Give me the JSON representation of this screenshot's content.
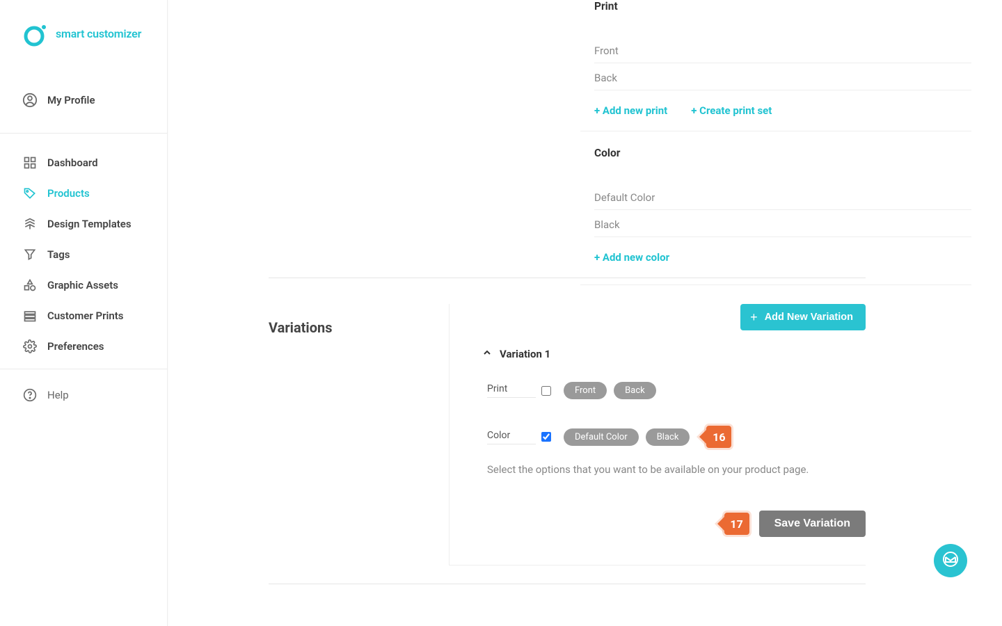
{
  "brand": "smart customizer",
  "sidebar": {
    "profile": "My Profile",
    "items": [
      "Dashboard",
      "Products",
      "Design Templates",
      "Tags",
      "Graphic Assets",
      "Customer Prints",
      "Preferences"
    ],
    "help": "Help"
  },
  "options": {
    "print": {
      "heading": "Print",
      "rows": [
        "Front",
        "Back"
      ],
      "add_new": "+ Add new print",
      "create_set": "+ Create print set"
    },
    "color": {
      "heading": "Color",
      "rows": [
        "Default Color",
        "Black"
      ],
      "add_new": "+ Add new color"
    }
  },
  "variations": {
    "title": "Variations",
    "add_new": "Add New Variation",
    "variation1": {
      "title": "Variation 1",
      "print_label": "Print",
      "print_pills": [
        "Front",
        "Back"
      ],
      "color_label": "Color",
      "color_pills": [
        "Default Color",
        "Black"
      ],
      "help": "Select the options that you want to be available on your product page.",
      "save": "Save Variation"
    }
  },
  "callouts": {
    "c16": "16",
    "c17": "17"
  }
}
